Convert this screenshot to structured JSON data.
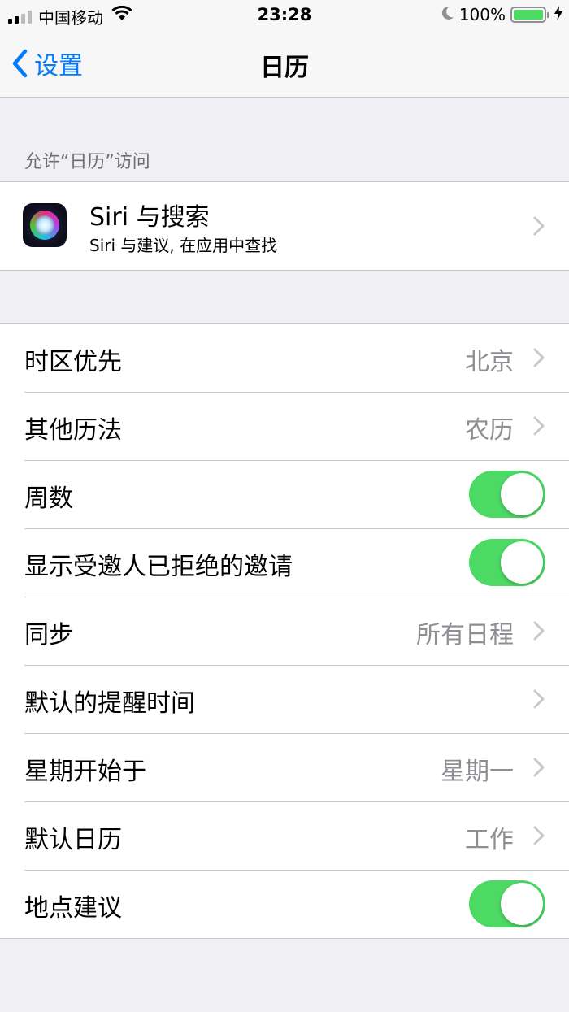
{
  "status_bar": {
    "carrier": "中国移动",
    "time": "23:28",
    "battery": "100%",
    "signal_bars": 4,
    "signal_bars_filled": 2
  },
  "nav": {
    "back_label": "设置",
    "title": "日历"
  },
  "section_header": "允许“日历”访问",
  "siri": {
    "title": "Siri 与搜索",
    "subtitle": "Siri 与建议, 在应用中查找"
  },
  "settings": [
    {
      "label": "时区优先",
      "value": "北京",
      "kind": "disclosure"
    },
    {
      "label": "其他历法",
      "value": "农历",
      "kind": "disclosure"
    },
    {
      "label": "周数",
      "kind": "toggle",
      "on": true
    },
    {
      "label": "显示受邀人已拒绝的邀请",
      "kind": "toggle",
      "on": true
    },
    {
      "label": "同步",
      "value": "所有日程",
      "kind": "disclosure"
    },
    {
      "label": "默认的提醒时间",
      "value": "",
      "kind": "disclosure"
    },
    {
      "label": "星期开始于",
      "value": "星期一",
      "kind": "disclosure"
    },
    {
      "label": "默认日历",
      "value": "工作",
      "kind": "disclosure"
    },
    {
      "label": "地点建议",
      "kind": "toggle",
      "on": true
    }
  ],
  "colors": {
    "accent": "#007aff",
    "toggle_on": "#4cd964",
    "background": "#efeff4",
    "secondary_text": "#8e8e93"
  }
}
